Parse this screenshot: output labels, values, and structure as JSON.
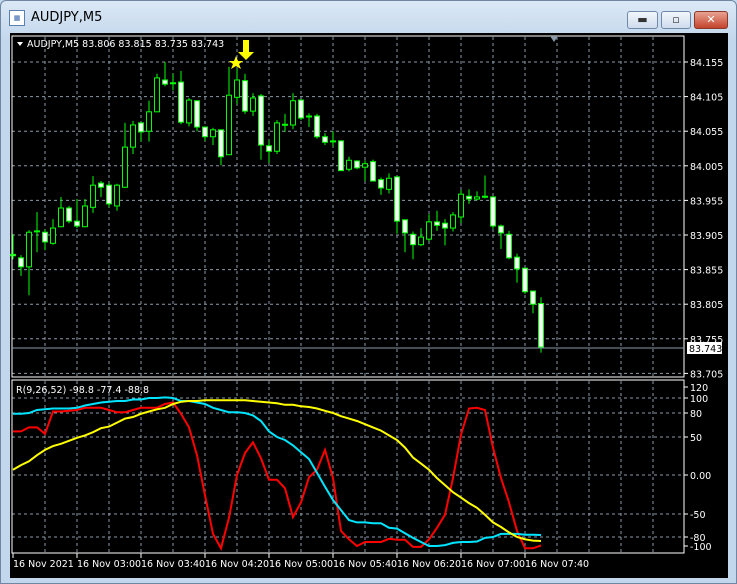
{
  "window": {
    "title": "AUDJPY,M5",
    "icon": "chart-window-icon",
    "minimize": "▬",
    "maximize": "▫",
    "close": "✕"
  },
  "chart": {
    "legend": "AUDJPY,M5  83.806 83.815 83.735 83.743",
    "current_price": "83.743",
    "price_ticks": [
      "84.155",
      "84.105",
      "84.055",
      "84.005",
      "83.955",
      "83.905",
      "83.855",
      "83.805",
      "83.755",
      "83.705"
    ],
    "time_labels": [
      "16 Nov 2021",
      "16 Nov 03:00",
      "16 Nov 03:40",
      "16 Nov 04:20",
      "16 Nov 05:00",
      "16 Nov 05:40",
      "16 Nov 06:20",
      "16 Nov 07:00",
      "16 Nov 07:40"
    ],
    "colors": {
      "background": "#000000",
      "grid": "#8c9aa8",
      "bull": "#00ff00",
      "bear_fill": "#ffffff",
      "arrow": "#ffff00"
    }
  },
  "indicator": {
    "legend": "R(9,26,52) -98.8 -77.4 -88.8",
    "ticks": [
      "120",
      "100",
      "80",
      "50",
      "0.00",
      "-50",
      "-80",
      "-100"
    ],
    "tick_values": [
      120,
      100,
      80,
      50,
      0,
      -50,
      -80,
      -100
    ],
    "colors": {
      "fast": "#ff0000",
      "mid": "#00e5ff",
      "slow": "#ffff00"
    }
  },
  "chart_data": {
    "type": "candlestick",
    "symbol": "AUDJPY",
    "timeframe": "M5",
    "ylim": [
      83.705,
      84.155
    ],
    "ohlc_order": "open,close,high,low",
    "candles": [
      [
        83.877,
        83.875,
        83.906,
        83.87
      ],
      [
        83.872,
        83.859,
        83.876,
        83.846
      ],
      [
        83.859,
        83.909,
        83.912,
        83.818
      ],
      [
        83.911,
        83.91,
        83.938,
        83.88
      ],
      [
        83.909,
        83.895,
        83.913,
        83.883
      ],
      [
        83.893,
        83.915,
        83.928,
        83.891
      ],
      [
        83.917,
        83.944,
        83.96,
        83.916
      ],
      [
        83.944,
        83.925,
        83.947,
        83.922
      ],
      [
        83.925,
        83.918,
        83.957,
        83.915
      ],
      [
        83.917,
        83.947,
        83.957,
        83.916
      ],
      [
        83.945,
        83.977,
        83.99,
        83.937
      ],
      [
        83.98,
        83.974,
        83.983,
        83.96
      ],
      [
        83.977,
        83.95,
        83.98,
        83.945
      ],
      [
        83.947,
        83.977,
        83.979,
        83.94
      ],
      [
        83.974,
        84.032,
        84.067,
        83.973
      ],
      [
        84.032,
        84.064,
        84.07,
        84.022
      ],
      [
        84.067,
        84.054,
        84.067,
        84.04
      ],
      [
        84.055,
        84.083,
        84.099,
        84.04
      ],
      [
        84.083,
        84.132,
        84.138,
        84.083
      ],
      [
        84.129,
        84.123,
        84.155,
        84.12
      ],
      [
        84.125,
        84.125,
        84.138,
        84.114
      ],
      [
        84.126,
        84.068,
        84.142,
        84.065
      ],
      [
        84.067,
        84.1,
        84.103,
        84.062
      ],
      [
        84.099,
        84.061,
        84.099,
        84.055
      ],
      [
        84.061,
        84.047,
        84.062,
        84.041
      ],
      [
        84.047,
        84.057,
        84.06,
        84.035
      ],
      [
        84.057,
        84.018,
        84.057,
        84.006
      ],
      [
        84.021,
        84.107,
        84.148,
        84.021
      ],
      [
        84.104,
        84.129,
        84.145,
        84.094
      ],
      [
        84.128,
        84.084,
        84.138,
        84.08
      ],
      [
        84.084,
        84.103,
        84.11,
        84.077
      ],
      [
        84.106,
        84.035,
        84.109,
        84.014
      ],
      [
        84.034,
        84.026,
        84.042,
        84.009
      ],
      [
        84.026,
        84.067,
        84.071,
        84.022
      ],
      [
        84.065,
        84.064,
        84.08,
        84.054
      ],
      [
        84.064,
        84.099,
        84.11,
        84.058
      ],
      [
        84.1,
        84.074,
        84.1,
        84.071
      ],
      [
        84.077,
        84.077,
        84.081,
        84.061
      ],
      [
        84.077,
        84.047,
        84.08,
        84.044
      ],
      [
        84.047,
        84.039,
        84.052,
        84.035
      ],
      [
        84.041,
        84.041,
        84.055,
        84.033
      ],
      [
        84.041,
        83.998,
        84.042,
        83.998
      ],
      [
        84.0,
        84.013,
        84.018,
        83.997
      ],
      [
        84.012,
        84.002,
        84.013,
        84.0
      ],
      [
        84.003,
        84.008,
        84.013,
        83.983
      ],
      [
        84.011,
        83.983,
        84.014,
        83.983
      ],
      [
        83.985,
        83.973,
        83.988,
        83.963
      ],
      [
        83.971,
        83.987,
        83.994,
        83.965
      ],
      [
        83.989,
        83.925,
        83.989,
        83.907
      ],
      [
        83.927,
        83.908,
        83.927,
        83.88
      ],
      [
        83.906,
        83.891,
        83.91,
        83.87
      ],
      [
        83.891,
        83.902,
        83.915,
        83.889
      ],
      [
        83.899,
        83.924,
        83.935,
        83.896
      ],
      [
        83.924,
        83.919,
        83.94,
        83.911
      ],
      [
        83.922,
        83.915,
        83.928,
        83.89
      ],
      [
        83.915,
        83.934,
        83.938,
        83.91
      ],
      [
        83.931,
        83.964,
        83.97,
        83.922
      ],
      [
        83.961,
        83.957,
        83.971,
        83.95
      ],
      [
        83.957,
        83.96,
        83.968,
        83.955
      ],
      [
        83.961,
        83.96,
        83.991,
        83.958
      ],
      [
        83.96,
        83.918,
        83.961,
        83.914
      ],
      [
        83.918,
        83.908,
        83.92,
        83.885
      ],
      [
        83.906,
        83.872,
        83.911,
        83.87
      ],
      [
        83.873,
        83.856,
        83.878,
        83.836
      ],
      [
        83.857,
        83.823,
        83.857,
        83.82
      ],
      [
        83.824,
        83.805,
        83.824,
        83.792
      ],
      [
        83.806,
        83.743,
        83.815,
        83.735
      ]
    ],
    "signal_candle_index": 28,
    "indicator_series": [
      {
        "name": "fast",
        "values": [
          57,
          57,
          62,
          62,
          54,
          82,
          82,
          83,
          84,
          87,
          87,
          87,
          84,
          81,
          81,
          84,
          87,
          87,
          87,
          92,
          94,
          79,
          62,
          26,
          -26,
          -76,
          -105,
          -55,
          0,
          29,
          43,
          22,
          -6,
          -6,
          -17,
          -54,
          -35,
          -3,
          7,
          33,
          -4,
          -72,
          -85,
          -100,
          -91,
          -91,
          -91,
          -84,
          -86,
          -86,
          -102,
          -102,
          -85,
          -68,
          -51,
          -4,
          53,
          86,
          87,
          84,
          36,
          -4,
          -35,
          -72,
          -105,
          -105,
          -98.8
        ]
      },
      {
        "name": "mid",
        "values": [
          79,
          79,
          80,
          84,
          85,
          86,
          86,
          86,
          87,
          90,
          92,
          94,
          95,
          96,
          96,
          98,
          98,
          100,
          100,
          101,
          100,
          96,
          96,
          94,
          92,
          87,
          84,
          81,
          81,
          80,
          77,
          70,
          57,
          50,
          46,
          39,
          30,
          21,
          3,
          -15,
          -32,
          -45,
          -58,
          -61,
          -61,
          -62,
          -62,
          -68,
          -69,
          -75,
          -82,
          -91,
          -100,
          -100,
          -98,
          -93,
          -91,
          -91,
          -90,
          -82,
          -80,
          -76,
          -76,
          -76,
          -77,
          -77,
          -77.4
        ]
      },
      {
        "name": "slow",
        "values": [
          7,
          13,
          18,
          26,
          33,
          38,
          41,
          45,
          49,
          52,
          56,
          61,
          63,
          68,
          73,
          75,
          79,
          82,
          85,
          87,
          92,
          95,
          96,
          96,
          97,
          97,
          97,
          97,
          97,
          97,
          96,
          95,
          94,
          93,
          91,
          91,
          89,
          88,
          86,
          83,
          80,
          76,
          73,
          70,
          66,
          62,
          58,
          52,
          46,
          36,
          23,
          15,
          7,
          -4,
          -13,
          -22,
          -29,
          -36,
          -42,
          -51,
          -61,
          -67,
          -74,
          -80,
          -85,
          -88,
          -88.8
        ]
      }
    ]
  }
}
